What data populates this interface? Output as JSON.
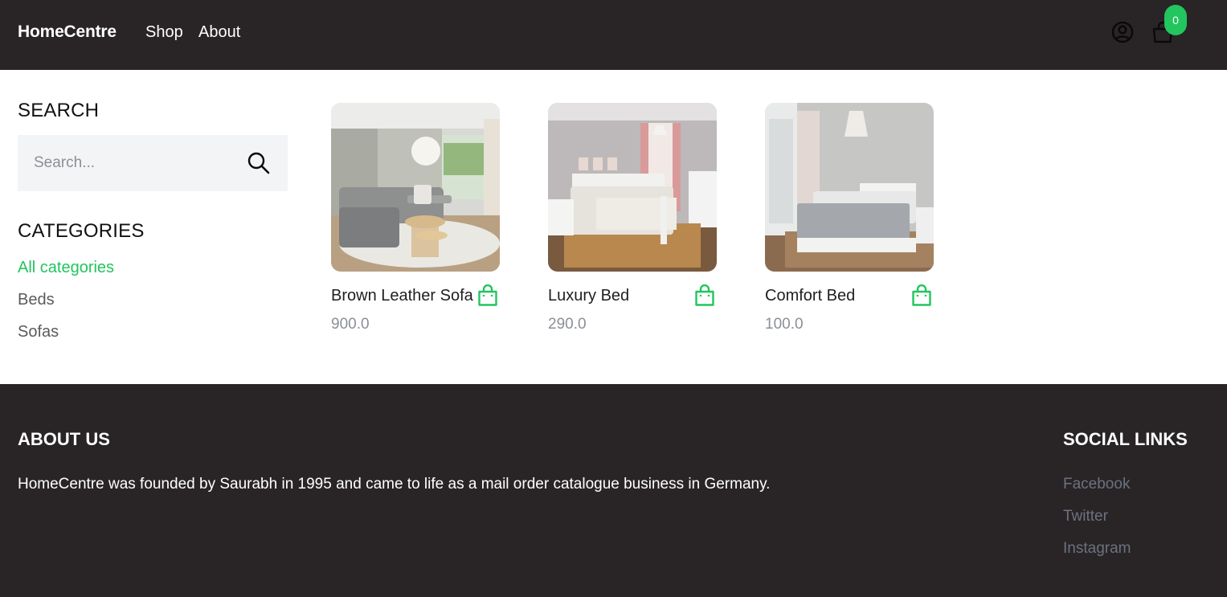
{
  "header": {
    "logo": "HomeCentre",
    "nav": {
      "shop": "Shop",
      "about": "About"
    },
    "icons": {
      "user": "user-circle-icon",
      "cart": "shopping-bag-icon"
    },
    "cart_count": "0"
  },
  "sidebar": {
    "search_heading": "SEARCH",
    "search_placeholder": "Search...",
    "search_value": "",
    "categories_heading": "CATEGORIES",
    "categories": [
      "All categories",
      "Beds",
      "Sofas"
    ],
    "active_category": "All categories"
  },
  "products": [
    {
      "name": "Brown Leather Sofa",
      "price": "900.0",
      "image": "living-room-sofa-photo"
    },
    {
      "name": "Luxury Bed",
      "price": "290.0",
      "image": "bedroom-white-bed-photo"
    },
    {
      "name": "Comfort Bed",
      "price": "100.0",
      "image": "bedroom-storage-bed-photo"
    }
  ],
  "footer": {
    "about_heading": "ABOUT US",
    "about_text": "HomeCentre was founded by Saurabh in 1995 and came to life as a mail order catalogue business in Germany.",
    "social_heading": "SOCIAL LINKS",
    "social_links": [
      "Facebook",
      "Twitter",
      "Instagram"
    ]
  },
  "colors": {
    "header_bg": "#292526",
    "accent": "#22c55e",
    "muted_text": "#8b8f96",
    "footer_link": "#6b7280"
  }
}
